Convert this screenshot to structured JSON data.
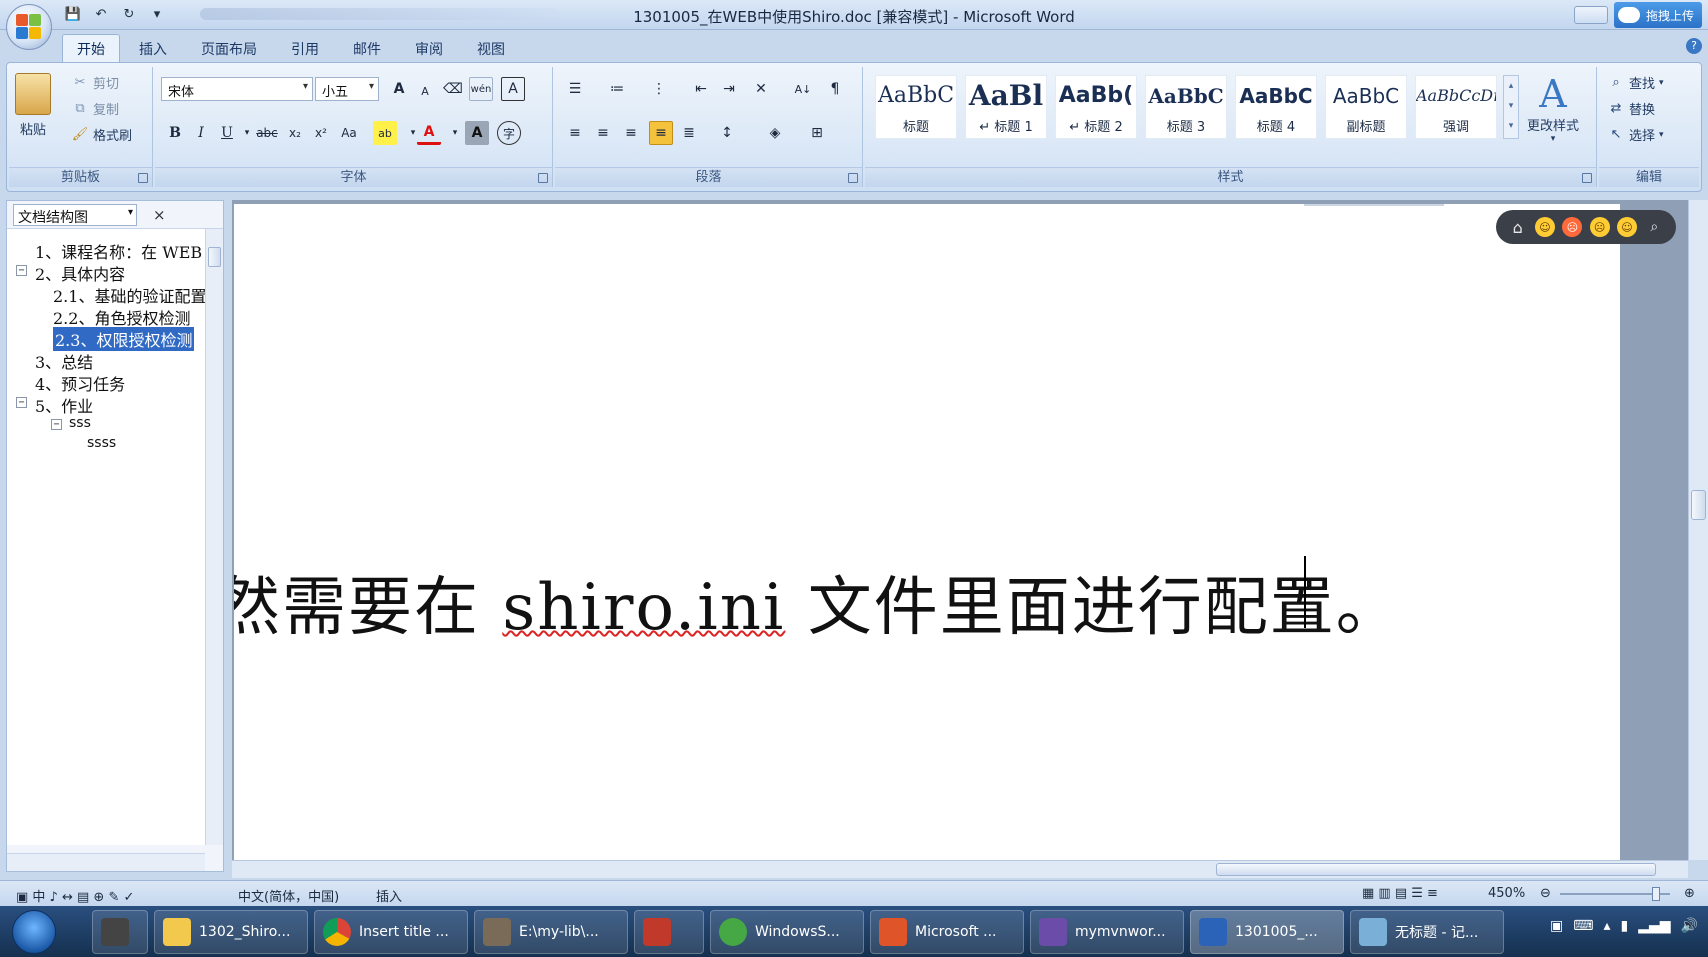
{
  "window": {
    "title": "1301005_在WEB中使用Shiro.doc [兼容模式] - Microsoft Word",
    "cloud_upload_label": "拖拽上传"
  },
  "ribbon_tabs": [
    "开始",
    "插入",
    "页面布局",
    "引用",
    "邮件",
    "审阅",
    "视图"
  ],
  "clipboard": {
    "paste_label": "粘贴",
    "cut_label": "剪切",
    "copy_label": "复制",
    "format_painter_label": "格式刷",
    "group_label": "剪贴板"
  },
  "font": {
    "font_name": "宋体",
    "font_size": "小五",
    "group_label": "字体",
    "bold": "B",
    "italic": "I",
    "underline": "U",
    "strike": "abc",
    "subscript": "x₂",
    "superscript": "x²",
    "change_case": "Aa",
    "grow": "A",
    "shrink": "A",
    "phonetic": "wén",
    "char_border": "A",
    "char_shading": "A",
    "enclose": "字"
  },
  "paragraph": {
    "group_label": "段落"
  },
  "styles": {
    "group_label": "样式",
    "items": [
      {
        "sample": "AaBbC",
        "name": "标题"
      },
      {
        "sample": "AaBl",
        "name": "↵ 标题 1"
      },
      {
        "sample": "AaBb(",
        "name": "↵ 标题 2"
      },
      {
        "sample": "AaBbC",
        "name": "标题 3"
      },
      {
        "sample": "AaBbC",
        "name": "标题 4"
      },
      {
        "sample": "AaBbC",
        "name": "副标题"
      },
      {
        "sample": "AaBbCcDı",
        "name": "强调"
      }
    ],
    "change_styles_label": "更改样式"
  },
  "editing": {
    "group_label": "编辑",
    "find_label": "查找",
    "replace_label": "替换",
    "select_label": "选择"
  },
  "nav_pane": {
    "view_label": "文档结构图",
    "close_label": "×",
    "items": [
      {
        "text": "1、课程名称：在 WEB",
        "level": 1,
        "toggle": ""
      },
      {
        "text": "2、具体内容",
        "level": 1,
        "toggle": "−"
      },
      {
        "text": "2.1、基础的验证配置",
        "level": 2,
        "toggle": ""
      },
      {
        "text": "2.2、角色授权检测",
        "level": 2,
        "toggle": ""
      },
      {
        "text": "2.3、权限授权检测",
        "level": 2,
        "toggle": "",
        "selected": true
      },
      {
        "text": "3、总结",
        "level": 1,
        "toggle": ""
      },
      {
        "text": "4、预习任务",
        "level": 1,
        "toggle": ""
      },
      {
        "text": "5、作业",
        "level": 1,
        "toggle": "−"
      },
      {
        "text": "sss",
        "level": 2,
        "toggle": "−"
      },
      {
        "text": "ssss",
        "level": 3,
        "toggle": ""
      }
    ]
  },
  "document": {
    "text_before": "然需要在 ",
    "text_misspelled": "shiro.ini",
    "text_after": " 文件里面进行配置。"
  },
  "status": {
    "language": "中文(简体，中国)",
    "mode": "插入",
    "zoom": "450%"
  },
  "taskbar": {
    "items": [
      {
        "label": "1302_Shiro...",
        "color": "#f2c94c"
      },
      {
        "label": "Insert title ...",
        "color": "#4caf50"
      },
      {
        "label": "E:\\my-lib\\...",
        "color": "#7a6a58"
      },
      {
        "label": "WindowsS...",
        "color": "#45a845"
      },
      {
        "label": "Microsoft ...",
        "color": "#e0542a"
      },
      {
        "label": "mymvnwor...",
        "color": "#6b4ca8"
      },
      {
        "label": "1301005_...",
        "color": "#2b63b8"
      },
      {
        "label": "无标题 - 记...",
        "color": "#7ab0d8"
      }
    ]
  }
}
